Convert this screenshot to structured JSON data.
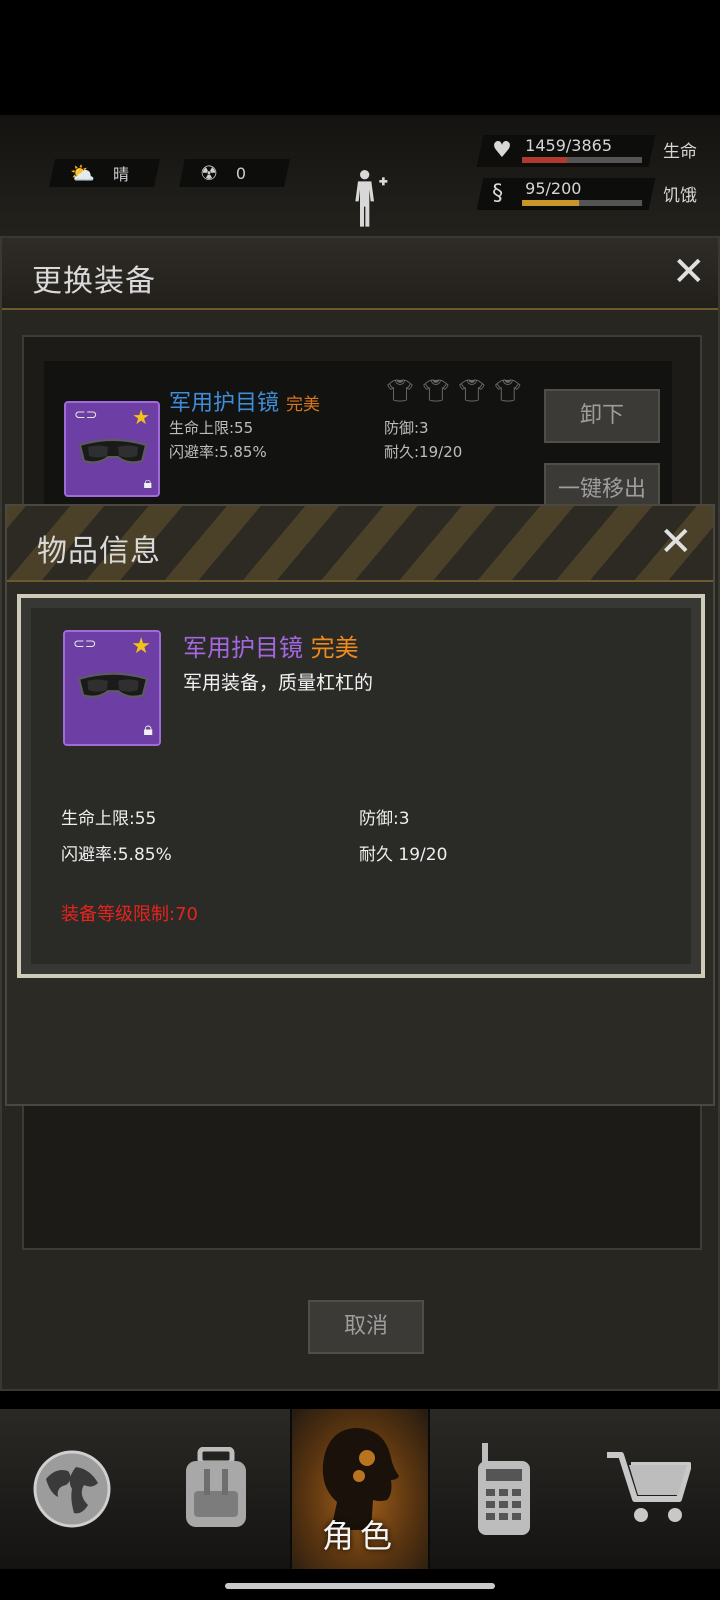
{
  "hud": {
    "weather": {
      "icon": "sun-cloud-icon",
      "label": "晴"
    },
    "radiation": {
      "icon": "radiation-icon",
      "value": "0"
    },
    "health": {
      "value": "1459/3865",
      "label": "生命",
      "fraction": 0.377,
      "color": "#b23a2c"
    },
    "hunger": {
      "value": "95/200",
      "label": "饥饿",
      "fraction": 0.475,
      "color": "#c9962a"
    }
  },
  "equip_dialog": {
    "title": "更换装备",
    "item": {
      "name": "军用护目镜",
      "quality": "完美",
      "hp_max": "生命上限:55",
      "dodge": "闪避率:5.85%",
      "defense": "防御:3",
      "durability": "耐久:19/20"
    },
    "unequip_label": "卸下",
    "remove_all_label": "一键移出",
    "cancel_label": "取消"
  },
  "item_info": {
    "title": "物品信息",
    "name": "军用护目镜",
    "quality": "完美",
    "description": "军用装备，质量杠杠的",
    "attrs": {
      "hp_max": "生命上限:55",
      "dodge": "闪避率:5.85%",
      "defense": "防御:3",
      "durability": "耐久 19/20"
    },
    "level_req": "装备等级限制:70"
  },
  "nav": {
    "items": [
      {
        "icon": "globe-icon"
      },
      {
        "icon": "backpack-icon"
      },
      {
        "icon": "head-silhouette-icon",
        "label": "角色",
        "active": true
      },
      {
        "icon": "walkie-talkie-icon"
      },
      {
        "icon": "shopping-cart-icon"
      }
    ]
  },
  "colors": {
    "accent_orange": "#f08a1c",
    "item_purple": "#a567e0",
    "item_blue": "#3f8cd8",
    "warning_red": "#e8231d"
  }
}
